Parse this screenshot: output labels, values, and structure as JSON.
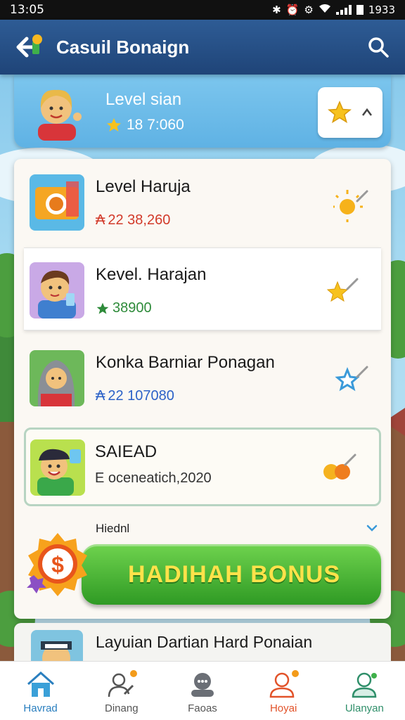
{
  "status_bar": {
    "time": "13:05",
    "battery_text": "1933"
  },
  "app_bar": {
    "title": "Casuil Bonaign"
  },
  "profile": {
    "title": "Level sian",
    "score": "18 7:060"
  },
  "items": [
    {
      "name": "Level Haruja",
      "meta": "22 38,260",
      "meta_prefix": "₳",
      "meta_color": "#d23a2a"
    },
    {
      "name": "Kevel. Harajan",
      "meta": "38900",
      "meta_color": "#2e8b3a"
    },
    {
      "name": "Konka Barniar Ponagan",
      "meta": "22 107080",
      "meta_prefix": "₳",
      "meta_color": "#2c62c8"
    },
    {
      "name": "SAIEAD",
      "meta": "E oceneatich,2020",
      "meta_color": "#2e8b3a"
    }
  ],
  "section": {
    "label": "Hiednl"
  },
  "bonus": {
    "label": "HADIHAH BONUS"
  },
  "next_item": {
    "name": "Layuian Dartian Hard Ponaian"
  },
  "bottom_nav": [
    {
      "label": "Havrad",
      "color": "#2a7fbf"
    },
    {
      "label": "Dinang",
      "color": "#555555"
    },
    {
      "label": "Faoas",
      "color": "#555555"
    },
    {
      "label": "Hoyai",
      "color": "#e2532a"
    },
    {
      "label": "Ulanyan",
      "color": "#2f8f6a"
    }
  ],
  "colors": {
    "app_bar": "#24507f",
    "bonus_green": "#3fae2e",
    "bonus_text": "#ffe24a",
    "accent_orange": "#f39b1a"
  }
}
